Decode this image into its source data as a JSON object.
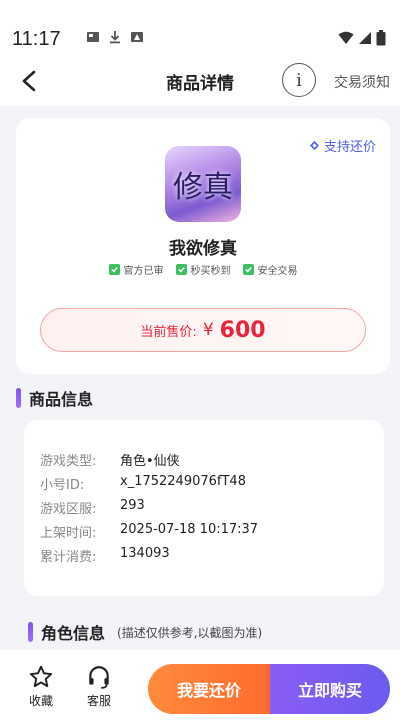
{
  "status": {
    "time": "11:17"
  },
  "nav": {
    "title": "商品详情",
    "info_glyph": "i",
    "rules_label": "交易须知"
  },
  "product": {
    "bargain_tag": "支持还价",
    "icon_text": "修真",
    "name": "我欲修真",
    "guarantees": [
      "官方已审",
      "秒买秒到",
      "安全交易"
    ],
    "price_label": "当前售价:",
    "price_currency": "¥",
    "price_value": "600"
  },
  "sections": {
    "product_info_title": "商品信息",
    "role_info_title": "角色信息",
    "role_info_note": "(描述仅供参考,以截图为准)"
  },
  "info_rows": [
    {
      "key": "游戏类型:",
      "value": "角色•仙侠"
    },
    {
      "key": "小号ID:",
      "value": "x_1752249076fT48"
    },
    {
      "key": "游戏区服:",
      "value": "293"
    },
    {
      "key": "上架时间:",
      "value": "2025-07-18 10:17:37"
    },
    {
      "key": "累计消费:",
      "value": "134093"
    }
  ],
  "bottom": {
    "favorite_label": "收藏",
    "service_label": "客服",
    "bargain_button": "我要还价",
    "buy_button": "立即购买"
  },
  "colors": {
    "accent_purple": "#7b53f0",
    "price_red": "#e8263a",
    "bargain_orange": "#ff7a35",
    "link_blue": "#4e5ee8"
  },
  "icons": {
    "back": "chevron-left-icon",
    "info": "info-circle-icon",
    "favorite": "star-outline-icon",
    "service": "headset-icon",
    "check": "checkbox-checked-icon"
  }
}
